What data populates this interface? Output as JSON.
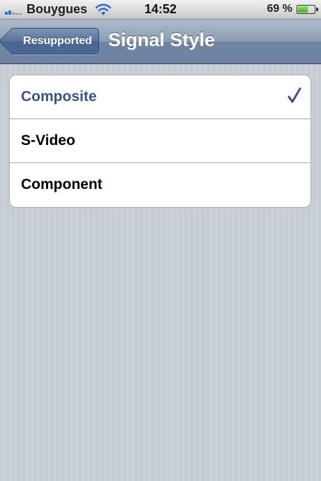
{
  "status_bar": {
    "carrier": "Bouygues",
    "time": "14:52",
    "battery_percent": "69 %",
    "battery_level": 0.69,
    "signal_icon": "signal-bars-icon",
    "wifi_icon": "wifi-icon",
    "battery_icon": "battery-icon"
  },
  "nav": {
    "back_label": "Resupported",
    "title": "Signal Style"
  },
  "options": [
    {
      "label": "Composite",
      "selected": true
    },
    {
      "label": "S-Video",
      "selected": false
    },
    {
      "label": "Component",
      "selected": false
    }
  ],
  "colors": {
    "selected_text": "#385487",
    "checkmark": "#385487"
  }
}
